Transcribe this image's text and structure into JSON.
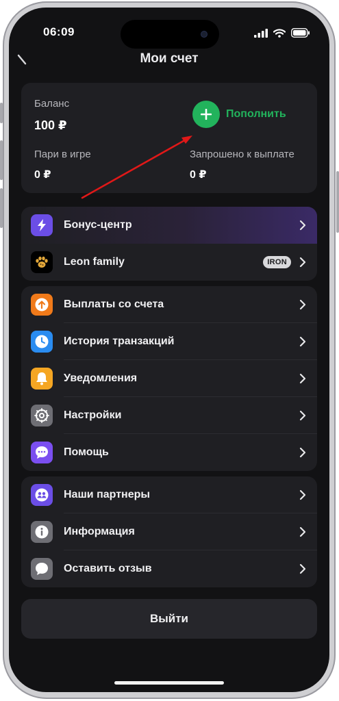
{
  "status_bar": {
    "time": "06:09"
  },
  "header": {
    "title": "Мои счет"
  },
  "balance": {
    "balance_label": "Баланс",
    "balance_value": "100 ₽",
    "in_play_label": "Пари в игре",
    "in_play_value": "0 ₽",
    "withdraw_label": "Запрошено к выплате",
    "withdraw_value": "0 ₽",
    "topup_label": "Пополнить"
  },
  "group1": [
    {
      "label": "Бонус-центр",
      "icon": "lightning-icon",
      "color": "#6b4ee6"
    },
    {
      "label": "Leon family",
      "icon": "paw-icon",
      "color": "#000000",
      "badge": "IRON"
    }
  ],
  "group2": [
    {
      "label": "Выплаты со счета",
      "icon": "arrow-up-circle-icon",
      "color": "#f07a1a"
    },
    {
      "label": "История транзакций",
      "icon": "clock-icon",
      "color": "#2a8cf0"
    },
    {
      "label": "Уведомления",
      "icon": "bell-icon",
      "color": "#f5a623"
    },
    {
      "label": "Настройки",
      "icon": "gear-icon",
      "color": "#6e6e74"
    },
    {
      "label": "Помощь",
      "icon": "chat-bubble-icon",
      "color": "#7b4ff0"
    }
  ],
  "group3": [
    {
      "label": "Наши партнеры",
      "icon": "people-icon",
      "color": "#6b4ee6"
    },
    {
      "label": "Информация",
      "icon": "info-icon",
      "color": "#6e6e74"
    },
    {
      "label": "Оставить отзыв",
      "icon": "speech-icon",
      "color": "#6e6e74"
    }
  ],
  "logout_label": "Выйти",
  "colors": {
    "accent_green": "#22b35c",
    "annotation_arrow": "#e01818",
    "background": "#121214"
  }
}
